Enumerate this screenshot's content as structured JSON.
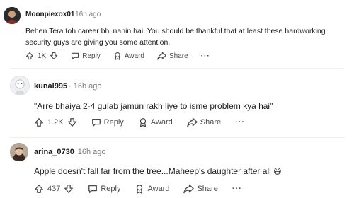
{
  "comments": [
    {
      "username": "Moonpiexox01",
      "meta": "· 16h ago",
      "body": "Behen Tera toh career bhi nahin hai. You should be thankful that at least these hardworking security guys are giving you some attention.",
      "votes": "1K",
      "reply_label": "Reply",
      "award_label": "Award",
      "share_label": "Share",
      "more_label": "···"
    },
    {
      "username": "kunal995",
      "meta": "· 16h ago",
      "body": "\"Arre bhaiya 2-4 gulab jamun rakh liye to isme problem kya hai\"",
      "votes": "1.2K",
      "reply_label": "Reply",
      "award_label": "Award",
      "share_label": "Share",
      "more_label": "···"
    },
    {
      "username": "arina_0730",
      "meta": "· 16h ago",
      "body": "Apple doesn't fall far from the tree...Maheep's daughter after all",
      "emoji": "😅",
      "votes": "437",
      "reply_label": "Reply",
      "award_label": "Award",
      "share_label": "Share",
      "more_label": "···"
    }
  ],
  "colors": {
    "text": "#1c1c1c",
    "meta": "#7c7c7c",
    "action": "#4a4a4a",
    "emoji": "#f5b82e"
  }
}
